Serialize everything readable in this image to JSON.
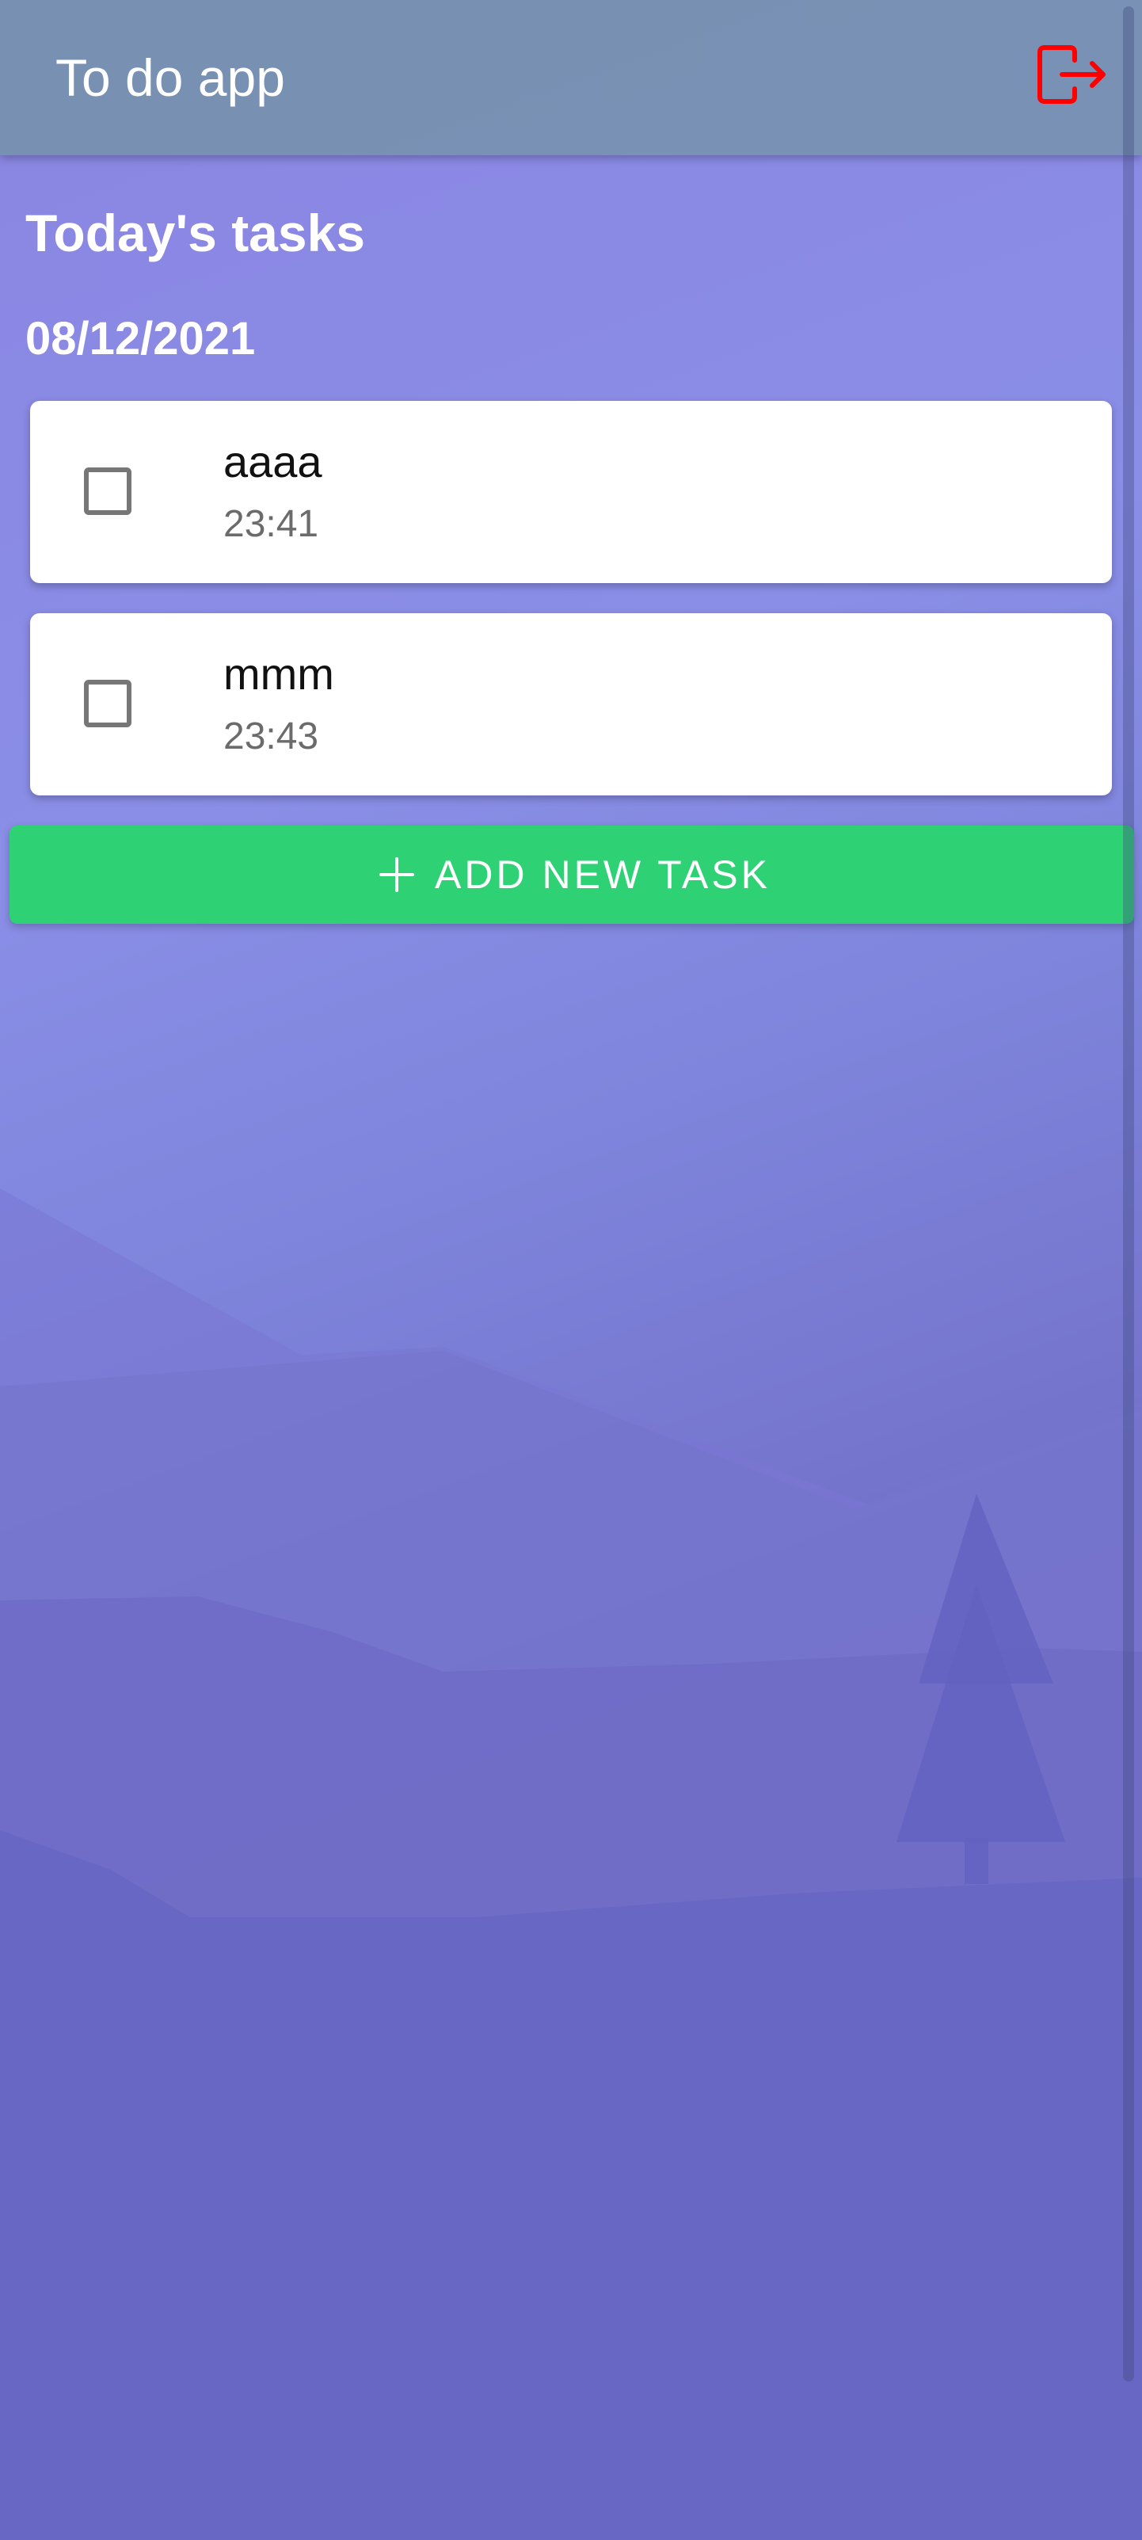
{
  "header": {
    "title": "To do app",
    "logout_icon": "logout-icon",
    "logout_color": "#ff0000"
  },
  "main": {
    "heading": "Today's tasks",
    "date": "08/12/2021",
    "tasks": [
      {
        "name": "aaaa",
        "time": "23:41",
        "checked": false
      },
      {
        "name": "mmm",
        "time": "23:43",
        "checked": false
      }
    ],
    "add_button": {
      "label": "ADD NEW TASK",
      "icon": "plus-icon",
      "color": "#2ed275"
    }
  }
}
